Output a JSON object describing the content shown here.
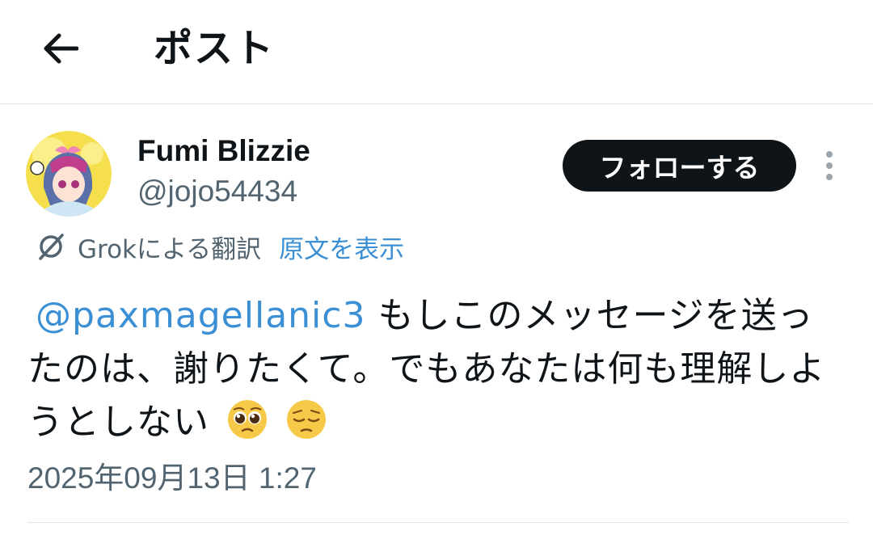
{
  "header": {
    "back_icon": "arrow-left-icon",
    "title": "ポスト"
  },
  "author": {
    "display_name": "Fumi Blizzie",
    "handle": "@jojo54434",
    "avatar_icon": "anime-avatar"
  },
  "follow_button": {
    "label": "フォローする"
  },
  "more_icon": "vertical-dots-icon",
  "translation": {
    "icon": "grok-icon",
    "label": "Grokによる翻訳",
    "show_original": "原文を表示"
  },
  "tweet": {
    "mention": "@paxmagellanic3",
    "text": "もしこのメッセージを送ったのは、謝りたくて。でもあなたは何も理解しようとしない",
    "emojis": [
      "pleading-face-emoji",
      "pensive-face-emoji"
    ]
  },
  "timestamp": "2025年09月13日 1:27",
  "colors": {
    "link": "#3b8fd4",
    "text": "#0f1419",
    "secondary": "#536471",
    "button_bg": "#0f1419",
    "divider": "#e3e6e8"
  }
}
